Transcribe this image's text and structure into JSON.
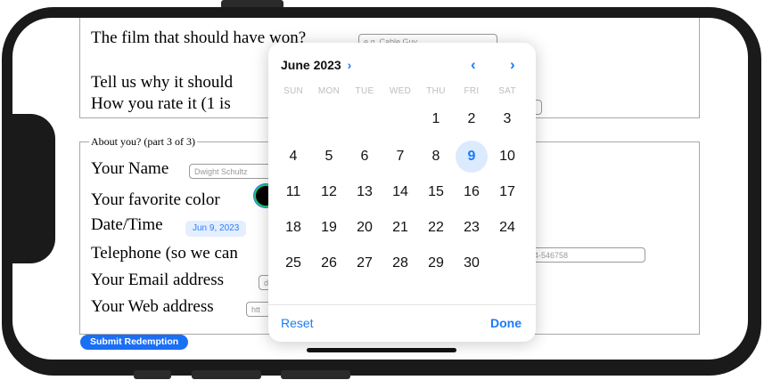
{
  "form": {
    "q_film": "The film that should have won?",
    "q_film_placeholder": "e.g. Cable Guy",
    "q_why": "Tell us why it should",
    "q_rate": "How you rate it (1 is",
    "fieldset_legend": "About you? (part 3 of 3)",
    "name_label": "Your Name",
    "name_placeholder": "Dwight Schultz",
    "color_label": "Your favorite color",
    "color_value": "#000000",
    "datetime_label": "Date/Time",
    "datetime_value": "Jun 9, 2023",
    "phone_label": "Telephone (so we can",
    "phone_placeholder": "4-546758",
    "email_label": "Your Email address",
    "email_placeholder": "d",
    "web_label": "Your Web address",
    "web_placeholder": "htt",
    "submit_label": "Submit Redemption"
  },
  "calendar": {
    "month_label": "June 2023",
    "month_chevron": "›",
    "prev_icon": "‹",
    "next_icon": "›",
    "weekdays": [
      "SUN",
      "MON",
      "TUE",
      "WED",
      "THU",
      "FRI",
      "SAT"
    ],
    "days": [
      "1",
      "2",
      "3",
      "4",
      "5",
      "6",
      "7",
      "8",
      "9",
      "10",
      "11",
      "12",
      "13",
      "14",
      "15",
      "16",
      "17",
      "18",
      "19",
      "20",
      "21",
      "22",
      "23",
      "24",
      "25",
      "26",
      "27",
      "28",
      "29",
      "30"
    ],
    "selected_day": "9",
    "reset_label": "Reset",
    "done_label": "Done",
    "accent_color": "#1a7cf7"
  }
}
